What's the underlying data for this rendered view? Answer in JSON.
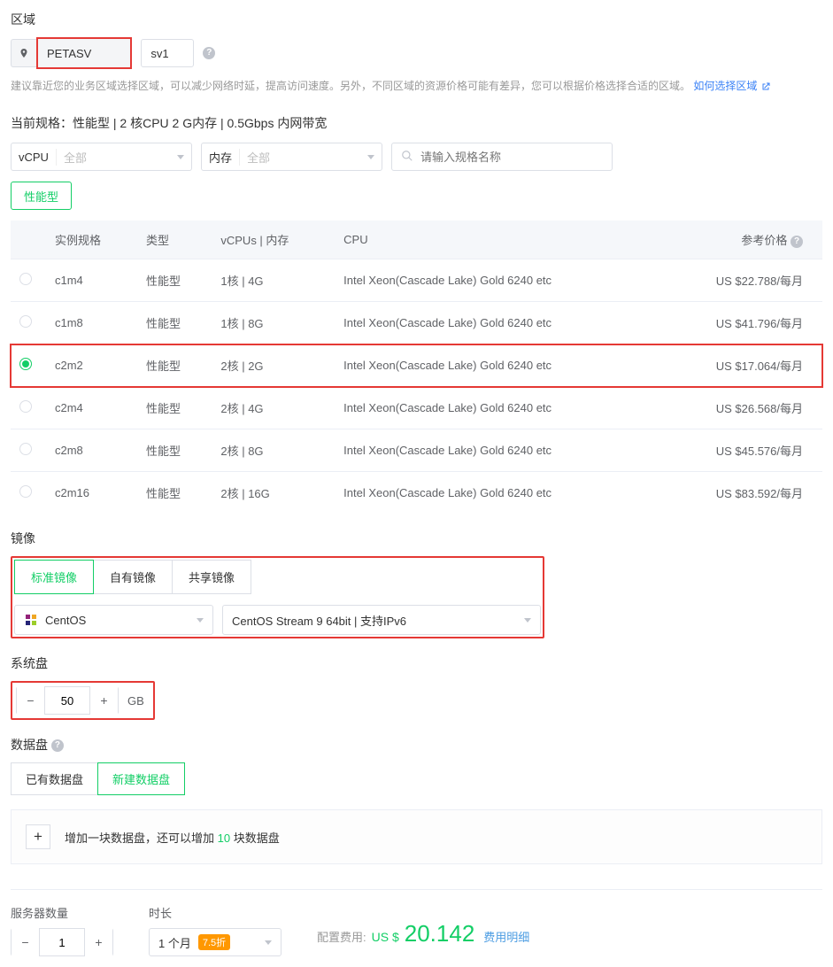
{
  "region": {
    "label": "区域",
    "selected": "PETASV",
    "other": "sv1",
    "hint_prefix": "建议靠近您的业务区域选择区域，可以减少网络时延，提高访问速度。另外，不同区域的资源价格可能有差异，您可以根据价格选择合适的区域。",
    "hint_link": "如何选择区域"
  },
  "spec_title_prefix": "当前规格：",
  "spec_title_value": "性能型 | 2 核CPU 2 G内存 | 0.5Gbps 内网带宽",
  "filters": {
    "vcpu_label": "vCPU",
    "vcpu_value": "全部",
    "mem_label": "内存",
    "mem_value": "全部",
    "search_placeholder": "请输入规格名称"
  },
  "type_tabs": {
    "performance": "性能型"
  },
  "table": {
    "headers": {
      "select": "",
      "spec": "实例规格",
      "type": "类型",
      "vcpus": "vCPUs | 内存",
      "cpu": "CPU",
      "price": "参考价格"
    },
    "rows": [
      {
        "spec": "c1m4",
        "type": "性能型",
        "vcpus": "1核 | 4G",
        "cpu": "Intel Xeon(Cascade Lake) Gold 6240 etc",
        "price": "US $22.788/每月",
        "selected": false
      },
      {
        "spec": "c1m8",
        "type": "性能型",
        "vcpus": "1核 | 8G",
        "cpu": "Intel Xeon(Cascade Lake) Gold 6240 etc",
        "price": "US $41.796/每月",
        "selected": false
      },
      {
        "spec": "c2m2",
        "type": "性能型",
        "vcpus": "2核 | 2G",
        "cpu": "Intel Xeon(Cascade Lake) Gold 6240 etc",
        "price": "US $17.064/每月",
        "selected": true
      },
      {
        "spec": "c2m4",
        "type": "性能型",
        "vcpus": "2核 | 4G",
        "cpu": "Intel Xeon(Cascade Lake) Gold 6240 etc",
        "price": "US $26.568/每月",
        "selected": false
      },
      {
        "spec": "c2m8",
        "type": "性能型",
        "vcpus": "2核 | 8G",
        "cpu": "Intel Xeon(Cascade Lake) Gold 6240 etc",
        "price": "US $45.576/每月",
        "selected": false
      },
      {
        "spec": "c2m16",
        "type": "性能型",
        "vcpus": "2核 | 16G",
        "cpu": "Intel Xeon(Cascade Lake) Gold 6240 etc",
        "price": "US $83.592/每月",
        "selected": false
      }
    ]
  },
  "image": {
    "label": "镜像",
    "tabs": {
      "standard": "标准镜像",
      "own": "自有镜像",
      "shared": "共享镜像"
    },
    "os": "CentOS",
    "version": "CentOS Stream 9 64bit | 支持IPv6"
  },
  "system_disk": {
    "label": "系统盘",
    "value": "50",
    "unit": "GB"
  },
  "data_disk": {
    "label": "数据盘",
    "tabs": {
      "existing": "已有数据盘",
      "new": "新建数据盘"
    },
    "add_text_prefix": "增加一块数据盘，还可以增加 ",
    "add_count": "10",
    "add_text_suffix": " 块数据盘"
  },
  "footer": {
    "qty_label": "服务器数量",
    "qty_value": "1",
    "duration_label": "时长",
    "duration_value": "1 个月",
    "discount": "7.5折",
    "cost_label": "配置费用:",
    "cost_currency": "US $",
    "cost_amount": "20.142",
    "cost_detail": "费用明细"
  }
}
